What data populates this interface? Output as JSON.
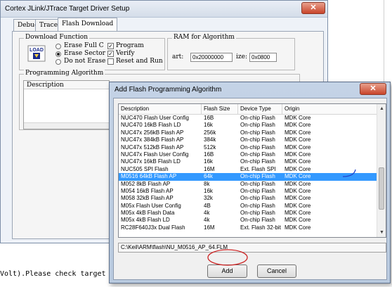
{
  "back_dialog": {
    "title": "Cortex JLink/JTrace Target Driver Setup",
    "close_glyph": "✕",
    "tabs": [
      {
        "label": "Debug"
      },
      {
        "label": "Trace"
      },
      {
        "label": "Flash Download"
      }
    ],
    "download_function": {
      "title": "Download Function",
      "load_icon_text": "LOAD",
      "options": [
        {
          "label": "Erase Full C",
          "selected": false
        },
        {
          "label": "Erase Sector",
          "selected": true
        },
        {
          "label": "Do not Erase",
          "selected": false
        }
      ],
      "checks": [
        {
          "label": "Program",
          "checked": true
        },
        {
          "label": "Verify",
          "checked": true
        },
        {
          "label": "Reset and Run",
          "checked": false
        }
      ]
    },
    "ram_for_algorithm": {
      "title": "RAM for Algorithm",
      "start_label": "art:",
      "start_value": "0x20000000",
      "size_label": "ize:",
      "size_value": "0x0800"
    },
    "programming_algorithm": {
      "title": "Programming Algorithm",
      "column_description": "Description"
    }
  },
  "console": {
    "line": "Volt).Please check target power."
  },
  "add_dialog": {
    "title": "Add Flash Programming Algorithm",
    "close_glyph": "✕",
    "columns": [
      "Description",
      "Flash Size",
      "Device Type",
      "Origin"
    ],
    "rows": [
      {
        "description": "NUC470 Flash User Config",
        "size": "16B",
        "type": "On-chip Flash",
        "origin": "MDK Core"
      },
      {
        "description": "NUC470 16kB Flash LD",
        "size": "16k",
        "type": "On-chip Flash",
        "origin": "MDK Core"
      },
      {
        "description": "NUC47x 256kB Flash AP",
        "size": "256k",
        "type": "On-chip Flash",
        "origin": "MDK Core"
      },
      {
        "description": "NUC47x 384kB Flash AP",
        "size": "384k",
        "type": "On-chip Flash",
        "origin": "MDK Core"
      },
      {
        "description": "NUC47x 512kB Flash AP",
        "size": "512k",
        "type": "On-chip Flash",
        "origin": "MDK Core"
      },
      {
        "description": "NUC47x Flash User Config",
        "size": "16B",
        "type": "On-chip Flash",
        "origin": "MDK Core"
      },
      {
        "description": "NUC47x 16kB Flash LD",
        "size": "16k",
        "type": "On-chip Flash",
        "origin": "MDK Core"
      },
      {
        "description": "NUC505 SPI Flash",
        "size": "16M",
        "type": "Ext. Flash SPI",
        "origin": "MDK Core"
      },
      {
        "description": "M0516 64kB Flash AP",
        "size": "64k",
        "type": "On-chip Flash",
        "origin": "MDK Core"
      },
      {
        "description": "M052 8kB Flash AP",
        "size": "8k",
        "type": "On-chip Flash",
        "origin": "MDK Core"
      },
      {
        "description": "M054 16kB Flash AP",
        "size": "16k",
        "type": "On-chip Flash",
        "origin": "MDK Core"
      },
      {
        "description": "M058 32kB Flash AP",
        "size": "32k",
        "type": "On-chip Flash",
        "origin": "MDK Core"
      },
      {
        "description": "M05x Flash User Config",
        "size": "4B",
        "type": "On-chip Flash",
        "origin": "MDK Core"
      },
      {
        "description": "M05x 4kB Flash Data",
        "size": "4k",
        "type": "On-chip Flash",
        "origin": "MDK Core"
      },
      {
        "description": "M05x 4kB Flash LD",
        "size": "4k",
        "type": "On-chip Flash",
        "origin": "MDK Core"
      },
      {
        "description": "RC28F640J3x Dual Flash",
        "size": "16M",
        "type": "Ext. Flash 32-bit",
        "origin": "MDK Core"
      }
    ],
    "selected_index": 8,
    "path": "C:\\Keil\\ARM\\flash\\NU_M0516_AP_64.FLM",
    "add_label": "Add",
    "cancel_label": "Cancel",
    "scroll_up_glyph": "▲",
    "scroll_down_glyph": "▼",
    "colors": {
      "selection": "#3399ff",
      "annotation_red": "#cc2222",
      "annotation_blue": "#2244cc"
    }
  }
}
